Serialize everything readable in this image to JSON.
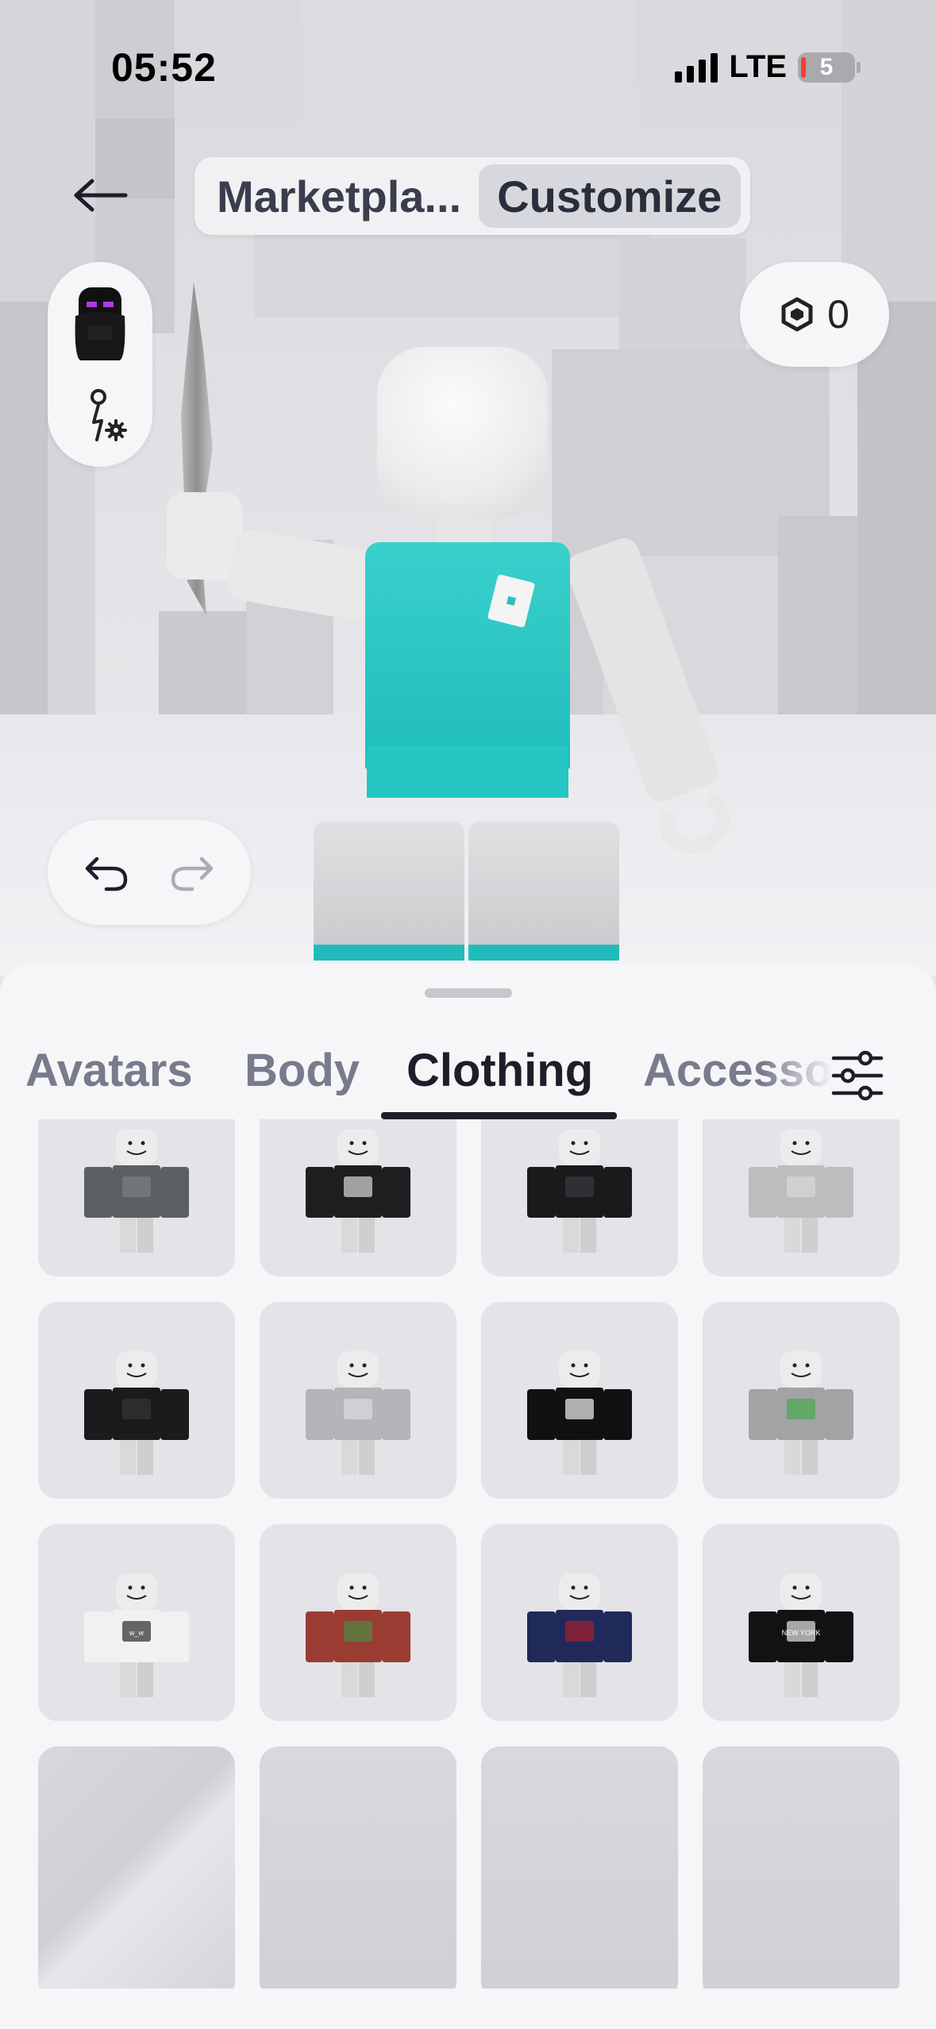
{
  "status_bar": {
    "time": "05:52",
    "network": "LTE",
    "battery": "5"
  },
  "nav": {
    "segments": [
      {
        "label": "Marketpla...",
        "active": false
      },
      {
        "label": "Customize",
        "active": true
      }
    ]
  },
  "wallet": {
    "robux": "0"
  },
  "sheet": {
    "tabs": [
      {
        "label": "Avatars",
        "active": false
      },
      {
        "label": "Body",
        "active": false
      },
      {
        "label": "Clothing",
        "active": true
      },
      {
        "label": "Accesso",
        "active": false
      }
    ]
  },
  "items": [
    {
      "name": "gray-wrinkled-shirt",
      "color": "#5c5f63",
      "accent": "#7a7d82",
      "text": ""
    },
    {
      "name": "black-biohazard-shirt",
      "color": "#1e1e20",
      "accent": "#d9d9d9",
      "text": ""
    },
    {
      "name": "black-puffer-jacket",
      "color": "#1a1a1c",
      "accent": "#3b3b3e",
      "text": ""
    },
    {
      "name": "silver-puffer-jacket",
      "color": "#bdbdc0",
      "accent": "#d8d8da",
      "text": ""
    },
    {
      "name": "black-jacket",
      "color": "#1b1b1d",
      "accent": "#333336",
      "text": ""
    },
    {
      "name": "gray-marble-shirt",
      "color": "#b4b5b8",
      "accent": "#dcdcde",
      "text": ""
    },
    {
      "name": "black-white-sleeve-shirt",
      "color": "#111113",
      "accent": "#f2f2f2",
      "text": ""
    },
    {
      "name": "gray-green-graphic-shirt",
      "color": "#a1a3a5",
      "accent": "#4aa84e",
      "text": ""
    },
    {
      "name": "white-graphic-tee",
      "color": "#f1f1f1",
      "accent": "#2a2a2a",
      "text": "w_w"
    },
    {
      "name": "graffiti-shirt",
      "color": "#9a3c32",
      "accent": "#4b8a3e",
      "text": ""
    },
    {
      "name": "striped-jersey",
      "color": "#1f2a5a",
      "accent": "#a51e2f",
      "text": ""
    },
    {
      "name": "new-york-shirt",
      "color": "#121214",
      "accent": "#e6e6e6",
      "text": "NEW YORK"
    }
  ]
}
